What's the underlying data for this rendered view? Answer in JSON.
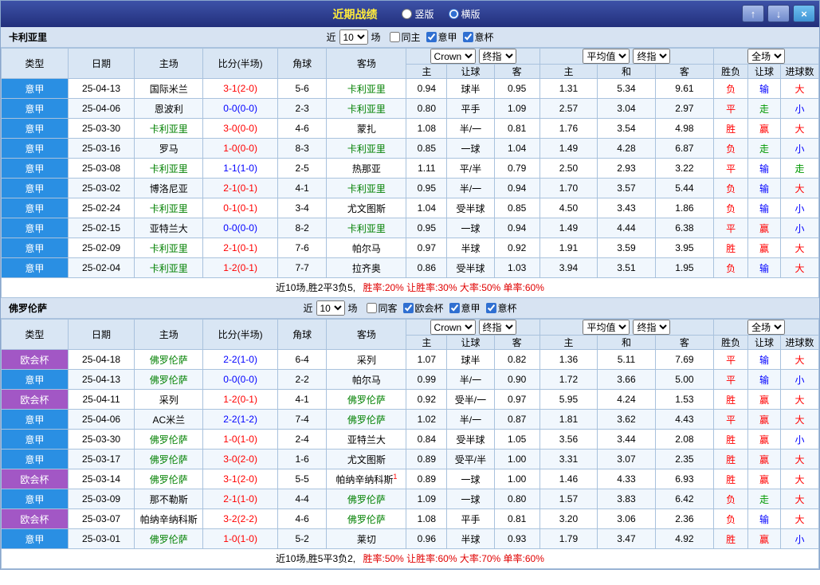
{
  "titlebar": {
    "title": "近期战绩",
    "layout_options": [
      {
        "label": "竖版",
        "selected": false
      },
      {
        "label": "横版",
        "selected": true
      }
    ],
    "buttons": {
      "up": "↑",
      "down": "↓",
      "close": "×"
    }
  },
  "filter": {
    "near_label": "近",
    "count": "10",
    "unit_label": "场"
  },
  "dropdowns": {
    "bookmaker": "Crown",
    "book_index": "终指",
    "average": "平均值",
    "avg_index": "终指",
    "scope": "全场"
  },
  "table_headers": {
    "type": "类型",
    "date": "日期",
    "home": "主场",
    "score": "比分(半场)",
    "corners": "角球",
    "away": "客场",
    "ah_home": "主",
    "ah_line": "让球",
    "ah_away": "客",
    "eu_home": "主",
    "eu_draw": "和",
    "eu_away": "客",
    "res_wdl": "胜负",
    "res_ah": "让球",
    "res_ou": "进球数"
  },
  "colors": {
    "league_blue": "#2a8fe3",
    "cup_purple": "#a257c5",
    "focus_team_green": "#008000",
    "win_red": "#ff0000",
    "loss_blue": "#0000ff",
    "push_green": "#009900",
    "title_yellow": "#ffeb3b"
  },
  "sections": [
    {
      "team": "卡利亚里",
      "checkboxes": [
        {
          "label": "同主",
          "checked": false
        },
        {
          "label": "意甲",
          "checked": true
        },
        {
          "label": "意杯",
          "checked": true
        }
      ],
      "rows": [
        {
          "comp": "意甲",
          "ct": "league",
          "date": "25-04-13",
          "home": "国际米兰",
          "hf": false,
          "score": "3-1(2-0)",
          "sc": "red",
          "corners": "5-6",
          "away": "卡利亚里",
          "af": true,
          "mark": "",
          "odds": [
            "0.94",
            "球半",
            "0.95"
          ],
          "euro": [
            "1.31",
            "5.34",
            "9.61"
          ],
          "res": [
            [
              "负",
              "red"
            ],
            [
              "输",
              "blue"
            ],
            [
              "大",
              "red"
            ]
          ]
        },
        {
          "comp": "意甲",
          "ct": "league",
          "date": "25-04-06",
          "home": "恩波利",
          "hf": false,
          "score": "0-0(0-0)",
          "sc": "blue",
          "corners": "2-3",
          "away": "卡利亚里",
          "af": true,
          "mark": "",
          "odds": [
            "0.80",
            "平手",
            "1.09"
          ],
          "euro": [
            "2.57",
            "3.04",
            "2.97"
          ],
          "res": [
            [
              "平",
              "red"
            ],
            [
              "走",
              "green"
            ],
            [
              "小",
              "blue"
            ]
          ]
        },
        {
          "comp": "意甲",
          "ct": "league",
          "date": "25-03-30",
          "home": "卡利亚里",
          "hf": true,
          "score": "3-0(0-0)",
          "sc": "red",
          "corners": "4-6",
          "away": "蒙扎",
          "af": false,
          "mark": "",
          "odds": [
            "1.08",
            "半/一",
            "0.81"
          ],
          "euro": [
            "1.76",
            "3.54",
            "4.98"
          ],
          "res": [
            [
              "胜",
              "red"
            ],
            [
              "赢",
              "red"
            ],
            [
              "大",
              "red"
            ]
          ]
        },
        {
          "comp": "意甲",
          "ct": "league",
          "date": "25-03-16",
          "home": "罗马",
          "hf": false,
          "score": "1-0(0-0)",
          "sc": "red",
          "corners": "8-3",
          "away": "卡利亚里",
          "af": true,
          "mark": "",
          "odds": [
            "0.85",
            "一球",
            "1.04"
          ],
          "euro": [
            "1.49",
            "4.28",
            "6.87"
          ],
          "res": [
            [
              "负",
              "red"
            ],
            [
              "走",
              "green"
            ],
            [
              "小",
              "blue"
            ]
          ]
        },
        {
          "comp": "意甲",
          "ct": "league",
          "date": "25-03-08",
          "home": "卡利亚里",
          "hf": true,
          "score": "1-1(1-0)",
          "sc": "blue",
          "corners": "2-5",
          "away": "热那亚",
          "af": false,
          "mark": "",
          "odds": [
            "1.11",
            "平/半",
            "0.79"
          ],
          "euro": [
            "2.50",
            "2.93",
            "3.22"
          ],
          "res": [
            [
              "平",
              "red"
            ],
            [
              "输",
              "blue"
            ],
            [
              "走",
              "green"
            ]
          ]
        },
        {
          "comp": "意甲",
          "ct": "league",
          "date": "25-03-02",
          "home": "博洛尼亚",
          "hf": false,
          "score": "2-1(0-1)",
          "sc": "red",
          "corners": "4-1",
          "away": "卡利亚里",
          "af": true,
          "mark": "",
          "odds": [
            "0.95",
            "半/一",
            "0.94"
          ],
          "euro": [
            "1.70",
            "3.57",
            "5.44"
          ],
          "res": [
            [
              "负",
              "red"
            ],
            [
              "输",
              "blue"
            ],
            [
              "大",
              "red"
            ]
          ]
        },
        {
          "comp": "意甲",
          "ct": "league",
          "date": "25-02-24",
          "home": "卡利亚里",
          "hf": true,
          "score": "0-1(0-1)",
          "sc": "red",
          "corners": "3-4",
          "away": "尤文图斯",
          "af": false,
          "mark": "",
          "odds": [
            "1.04",
            "受半球",
            "0.85"
          ],
          "euro": [
            "4.50",
            "3.43",
            "1.86"
          ],
          "res": [
            [
              "负",
              "red"
            ],
            [
              "输",
              "blue"
            ],
            [
              "小",
              "blue"
            ]
          ]
        },
        {
          "comp": "意甲",
          "ct": "league",
          "date": "25-02-15",
          "home": "亚特兰大",
          "hf": false,
          "score": "0-0(0-0)",
          "sc": "blue",
          "corners": "8-2",
          "away": "卡利亚里",
          "af": true,
          "mark": "",
          "odds": [
            "0.95",
            "一球",
            "0.94"
          ],
          "euro": [
            "1.49",
            "4.44",
            "6.38"
          ],
          "res": [
            [
              "平",
              "red"
            ],
            [
              "赢",
              "red"
            ],
            [
              "小",
              "blue"
            ]
          ]
        },
        {
          "comp": "意甲",
          "ct": "league",
          "date": "25-02-09",
          "home": "卡利亚里",
          "hf": true,
          "score": "2-1(0-1)",
          "sc": "red",
          "corners": "7-6",
          "away": "帕尔马",
          "af": false,
          "mark": "",
          "odds": [
            "0.97",
            "半球",
            "0.92"
          ],
          "euro": [
            "1.91",
            "3.59",
            "3.95"
          ],
          "res": [
            [
              "胜",
              "red"
            ],
            [
              "赢",
              "red"
            ],
            [
              "大",
              "red"
            ]
          ]
        },
        {
          "comp": "意甲",
          "ct": "league",
          "date": "25-02-04",
          "home": "卡利亚里",
          "hf": true,
          "score": "1-2(0-1)",
          "sc": "red",
          "corners": "7-7",
          "away": "拉齐奥",
          "af": false,
          "mark": "",
          "odds": [
            "0.86",
            "受半球",
            "1.03"
          ],
          "euro": [
            "3.94",
            "3.51",
            "1.95"
          ],
          "res": [
            [
              "负",
              "red"
            ],
            [
              "输",
              "blue"
            ],
            [
              "大",
              "red"
            ]
          ]
        }
      ],
      "summary_prefix": "近10场,胜2平3负5,",
      "summary_stats": "胜率:20% 让胜率:30% 大率:50% 单率:60%"
    },
    {
      "team": "佛罗伦萨",
      "checkboxes": [
        {
          "label": "同客",
          "checked": false
        },
        {
          "label": "欧会杯",
          "checked": true
        },
        {
          "label": "意甲",
          "checked": true
        },
        {
          "label": "意杯",
          "checked": true
        }
      ],
      "rows": [
        {
          "comp": "欧会杯",
          "ct": "cup",
          "date": "25-04-18",
          "home": "佛罗伦萨",
          "hf": true,
          "score": "2-2(1-0)",
          "sc": "blue",
          "corners": "6-4",
          "away": "采列",
          "af": false,
          "mark": "",
          "odds": [
            "1.07",
            "球半",
            "0.82"
          ],
          "euro": [
            "1.36",
            "5.11",
            "7.69"
          ],
          "res": [
            [
              "平",
              "red"
            ],
            [
              "输",
              "blue"
            ],
            [
              "大",
              "red"
            ]
          ]
        },
        {
          "comp": "意甲",
          "ct": "league",
          "date": "25-04-13",
          "home": "佛罗伦萨",
          "hf": true,
          "score": "0-0(0-0)",
          "sc": "blue",
          "corners": "2-2",
          "away": "帕尔马",
          "af": false,
          "mark": "",
          "odds": [
            "0.99",
            "半/一",
            "0.90"
          ],
          "euro": [
            "1.72",
            "3.66",
            "5.00"
          ],
          "res": [
            [
              "平",
              "red"
            ],
            [
              "输",
              "blue"
            ],
            [
              "小",
              "blue"
            ]
          ]
        },
        {
          "comp": "欧会杯",
          "ct": "cup",
          "date": "25-04-11",
          "home": "采列",
          "hf": false,
          "score": "1-2(0-1)",
          "sc": "red",
          "corners": "4-1",
          "away": "佛罗伦萨",
          "af": true,
          "mark": "",
          "odds": [
            "0.92",
            "受半/一",
            "0.97"
          ],
          "euro": [
            "5.95",
            "4.24",
            "1.53"
          ],
          "res": [
            [
              "胜",
              "red"
            ],
            [
              "赢",
              "red"
            ],
            [
              "大",
              "red"
            ]
          ]
        },
        {
          "comp": "意甲",
          "ct": "league",
          "date": "25-04-06",
          "home": "AC米兰",
          "hf": false,
          "score": "2-2(1-2)",
          "sc": "blue",
          "corners": "7-4",
          "away": "佛罗伦萨",
          "af": true,
          "mark": "",
          "odds": [
            "1.02",
            "半/一",
            "0.87"
          ],
          "euro": [
            "1.81",
            "3.62",
            "4.43"
          ],
          "res": [
            [
              "平",
              "red"
            ],
            [
              "赢",
              "red"
            ],
            [
              "大",
              "red"
            ]
          ]
        },
        {
          "comp": "意甲",
          "ct": "league",
          "date": "25-03-30",
          "home": "佛罗伦萨",
          "hf": true,
          "score": "1-0(1-0)",
          "sc": "red",
          "corners": "2-4",
          "away": "亚特兰大",
          "af": false,
          "mark": "",
          "odds": [
            "0.84",
            "受半球",
            "1.05"
          ],
          "euro": [
            "3.56",
            "3.44",
            "2.08"
          ],
          "res": [
            [
              "胜",
              "red"
            ],
            [
              "赢",
              "red"
            ],
            [
              "小",
              "blue"
            ]
          ]
        },
        {
          "comp": "意甲",
          "ct": "league",
          "date": "25-03-17",
          "home": "佛罗伦萨",
          "hf": true,
          "score": "3-0(2-0)",
          "sc": "red",
          "corners": "1-6",
          "away": "尤文图斯",
          "af": false,
          "mark": "",
          "odds": [
            "0.89",
            "受平/半",
            "1.00"
          ],
          "euro": [
            "3.31",
            "3.07",
            "2.35"
          ],
          "res": [
            [
              "胜",
              "red"
            ],
            [
              "赢",
              "red"
            ],
            [
              "大",
              "red"
            ]
          ]
        },
        {
          "comp": "欧会杯",
          "ct": "cup",
          "date": "25-03-14",
          "home": "佛罗伦萨",
          "hf": true,
          "score": "3-1(2-0)",
          "sc": "red",
          "corners": "5-5",
          "away": "帕纳辛纳科斯",
          "af": false,
          "mark": "1",
          "odds": [
            "0.89",
            "一球",
            "1.00"
          ],
          "euro": [
            "1.46",
            "4.33",
            "6.93"
          ],
          "res": [
            [
              "胜",
              "red"
            ],
            [
              "赢",
              "red"
            ],
            [
              "大",
              "red"
            ]
          ]
        },
        {
          "comp": "意甲",
          "ct": "league",
          "date": "25-03-09",
          "home": "那不勒斯",
          "hf": false,
          "score": "2-1(1-0)",
          "sc": "red",
          "corners": "4-4",
          "away": "佛罗伦萨",
          "af": true,
          "mark": "",
          "odds": [
            "1.09",
            "一球",
            "0.80"
          ],
          "euro": [
            "1.57",
            "3.83",
            "6.42"
          ],
          "res": [
            [
              "负",
              "red"
            ],
            [
              "走",
              "green"
            ],
            [
              "大",
              "red"
            ]
          ]
        },
        {
          "comp": "欧会杯",
          "ct": "cup",
          "date": "25-03-07",
          "home": "帕纳辛纳科斯",
          "hf": false,
          "score": "3-2(2-2)",
          "sc": "red",
          "corners": "4-6",
          "away": "佛罗伦萨",
          "af": true,
          "mark": "",
          "odds": [
            "1.08",
            "平手",
            "0.81"
          ],
          "euro": [
            "3.20",
            "3.06",
            "2.36"
          ],
          "res": [
            [
              "负",
              "red"
            ],
            [
              "输",
              "blue"
            ],
            [
              "大",
              "red"
            ]
          ]
        },
        {
          "comp": "意甲",
          "ct": "league",
          "date": "25-03-01",
          "home": "佛罗伦萨",
          "hf": true,
          "score": "1-0(1-0)",
          "sc": "red",
          "corners": "5-2",
          "away": "莱切",
          "af": false,
          "mark": "",
          "odds": [
            "0.96",
            "半球",
            "0.93"
          ],
          "euro": [
            "1.79",
            "3.47",
            "4.92"
          ],
          "res": [
            [
              "胜",
              "red"
            ],
            [
              "赢",
              "red"
            ],
            [
              "小",
              "blue"
            ]
          ]
        }
      ],
      "summary_prefix": "近10场,胜5平3负2,",
      "summary_stats": "胜率:50% 让胜率:60% 大率:70% 单率:60%"
    }
  ]
}
